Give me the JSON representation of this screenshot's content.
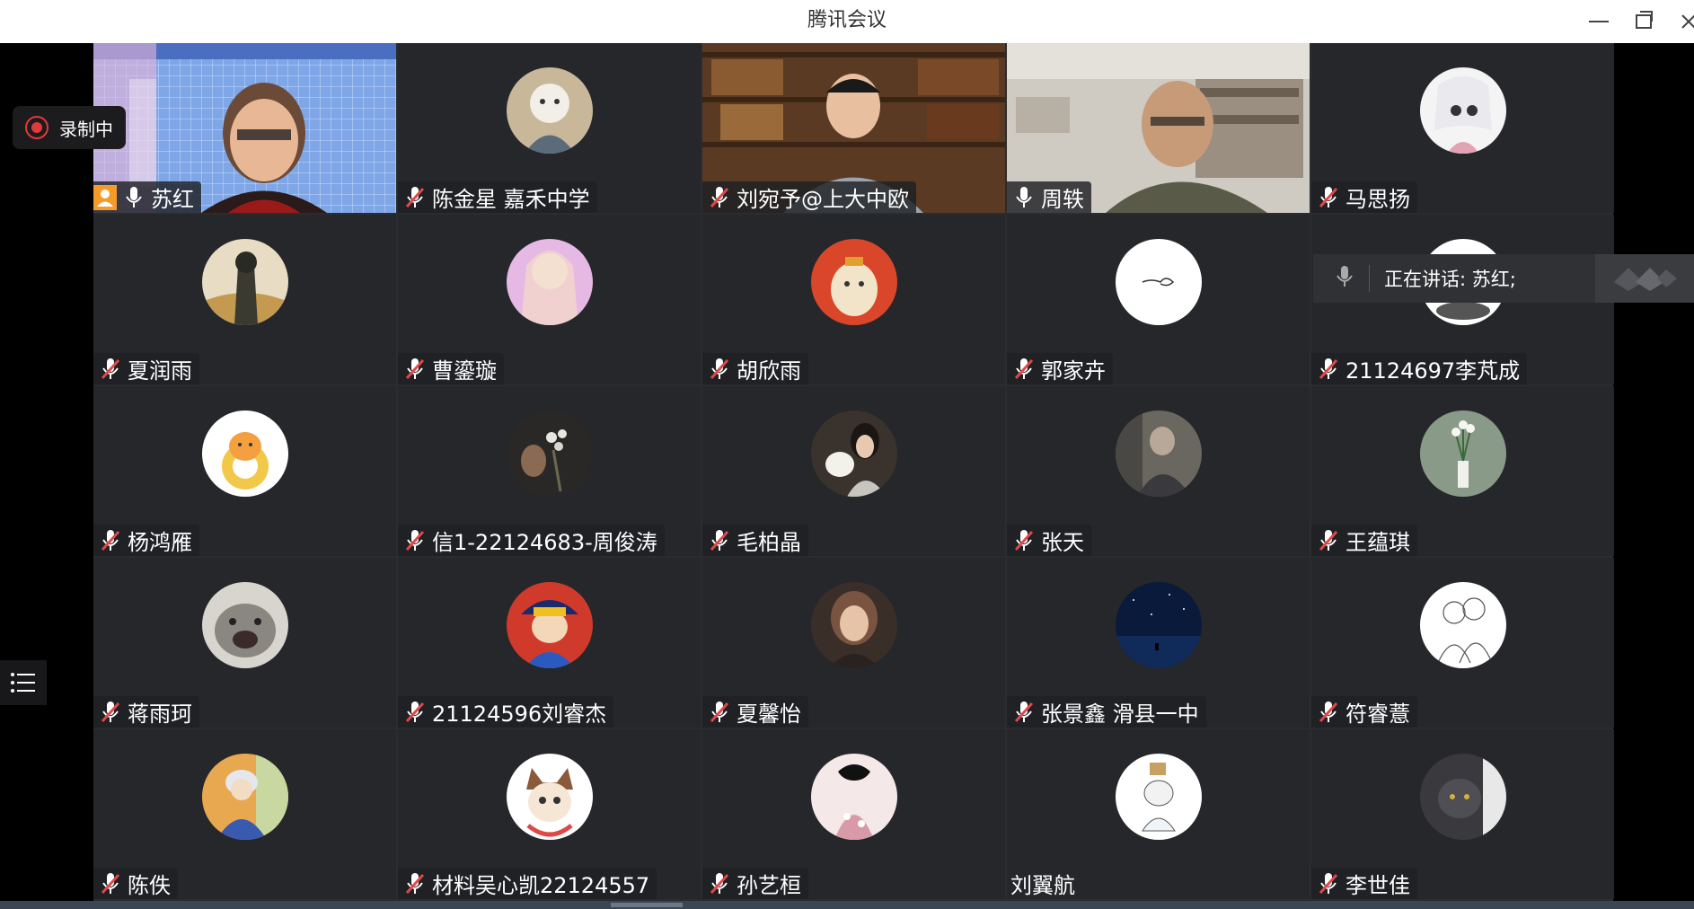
{
  "window": {
    "title": "腾讯会议"
  },
  "recording": {
    "label": "录制中"
  },
  "speaking": {
    "text": "正在讲话: 苏红;"
  },
  "participants": [
    {
      "name": "苏红",
      "mic": "on"
    },
    {
      "name": "陈金星 嘉禾中学",
      "mic": "muted"
    },
    {
      "name": "刘宛予@上大中欧",
      "mic": "muted"
    },
    {
      "name": "周轶",
      "mic": "on"
    },
    {
      "name": "马思扬",
      "mic": "muted"
    },
    {
      "name": "夏润雨",
      "mic": "muted"
    },
    {
      "name": "曹鎏璇",
      "mic": "muted"
    },
    {
      "name": "胡欣雨",
      "mic": "muted"
    },
    {
      "name": "郭家卉",
      "mic": "muted"
    },
    {
      "name": "21124697李芃成",
      "mic": "muted"
    },
    {
      "name": "杨鸿雁",
      "mic": "muted"
    },
    {
      "name": "信1-22124683-周俊涛",
      "mic": "muted"
    },
    {
      "name": "毛柏晶",
      "mic": "muted"
    },
    {
      "name": "张天",
      "mic": "muted"
    },
    {
      "name": "王蕴琪",
      "mic": "muted"
    },
    {
      "name": "蒋雨珂",
      "mic": "muted"
    },
    {
      "name": "21124596刘睿杰",
      "mic": "muted"
    },
    {
      "name": "夏馨怡",
      "mic": "muted"
    },
    {
      "name": "张景鑫 滑县一中",
      "mic": "muted"
    },
    {
      "name": "符睿薏",
      "mic": "muted"
    },
    {
      "name": "陈佚",
      "mic": "muted"
    },
    {
      "name": "材料吴心凯22124557",
      "mic": "muted"
    },
    {
      "name": "孙艺桓",
      "mic": "muted"
    },
    {
      "name": "刘翼航",
      "mic": "none"
    },
    {
      "name": "李世佳",
      "mic": "muted"
    }
  ],
  "colors": {
    "muted_icon": "#e04848",
    "accent": "#f49b2a"
  }
}
